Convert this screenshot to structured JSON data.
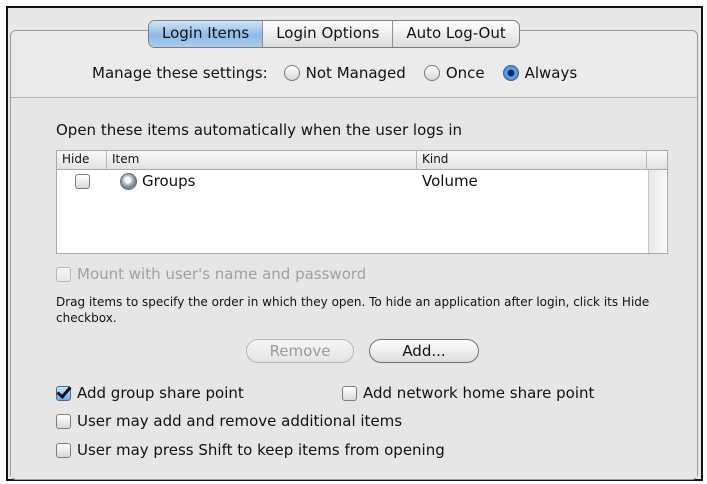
{
  "tabs": [
    {
      "label": "Login Items",
      "active": true
    },
    {
      "label": "Login Options",
      "active": false
    },
    {
      "label": "Auto Log-Out",
      "active": false
    }
  ],
  "manage": {
    "label": "Manage these settings:",
    "options": [
      {
        "label": "Not Managed",
        "selected": false
      },
      {
        "label": "Once",
        "selected": false
      },
      {
        "label": "Always",
        "selected": true
      }
    ]
  },
  "login_items": {
    "heading": "Open these items automatically when the user logs in",
    "columns": {
      "hide": "Hide",
      "item": "Item",
      "kind": "Kind"
    },
    "rows": [
      {
        "hide": false,
        "item": "Groups",
        "kind": "Volume",
        "icon": "volume-icon"
      }
    ]
  },
  "mount_checkbox": {
    "label": "Mount with user's name and password",
    "checked": false,
    "enabled": false
  },
  "help_text": "Drag items to specify the order in which they open. To hide an application after login, click its Hide checkbox.",
  "buttons": {
    "remove": "Remove",
    "add": "Add..."
  },
  "options": {
    "group_share": {
      "label": "Add group share point",
      "checked": true
    },
    "network_home": {
      "label": "Add network home share point",
      "checked": false
    },
    "user_add_remove": {
      "label": "User may add and remove additional items",
      "checked": false
    },
    "shift_keep": {
      "label": "User may press Shift to keep items from opening",
      "checked": false
    }
  },
  "colors": {
    "accent": "#6fa8e8",
    "panel": "#e8e8e8"
  }
}
